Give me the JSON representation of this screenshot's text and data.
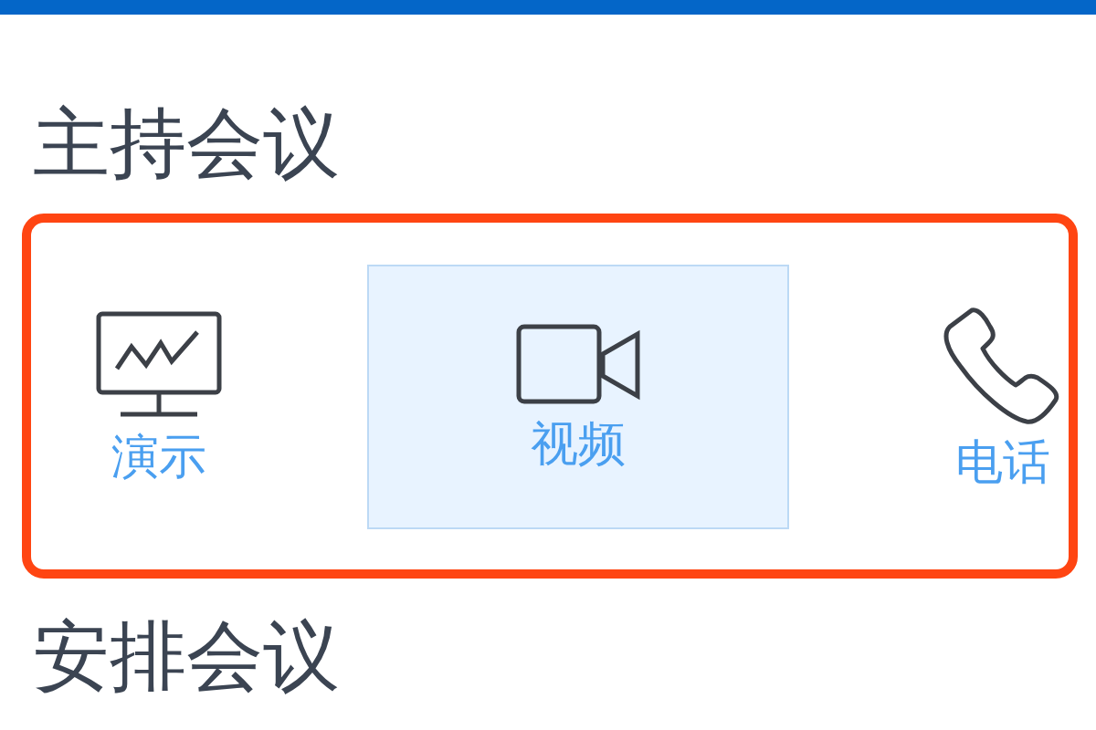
{
  "sections": [
    {
      "title": "主持会议",
      "options": [
        {
          "kind": "presentation",
          "label": "演示",
          "selected": false
        },
        {
          "kind": "video",
          "label": "视频",
          "selected": true
        },
        {
          "kind": "phone",
          "label": "电话",
          "selected": false
        }
      ]
    },
    {
      "title": "安排会议"
    }
  ]
}
